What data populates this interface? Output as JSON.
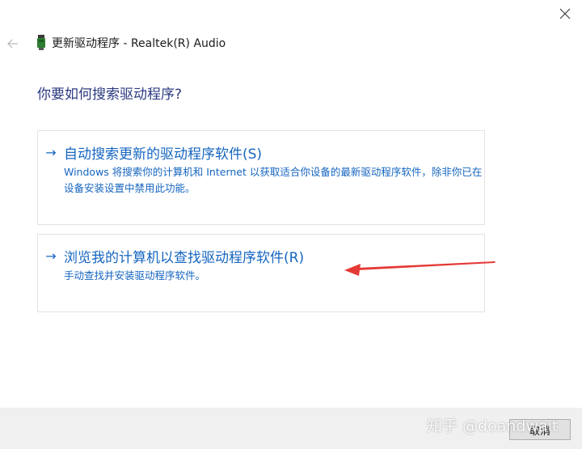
{
  "window": {
    "title": "更新驱动程序 - Realtek(R) Audio"
  },
  "page": {
    "heading": "你要如何搜索驱动程序?"
  },
  "options": [
    {
      "title": "自动搜索更新的驱动程序软件(S)",
      "description": "Windows 将搜索你的计算机和 Internet 以获取适合你设备的最新驱动程序软件，除非你已在设备安装设置中禁用此功能。"
    },
    {
      "title": "浏览我的计算机以查找驱动程序软件(R)",
      "description": "手动查找并安装驱动程序软件。"
    }
  ],
  "footer": {
    "cancel_label": "取消"
  },
  "watermark": {
    "text": "知乎 @doandwait"
  },
  "icons": {
    "close": "close-icon",
    "back": "back-arrow-icon",
    "device": "audio-device-icon",
    "option_arrow": "right-arrow-icon"
  },
  "colors": {
    "link_blue": "#1565c0",
    "annotation_red": "#e53935",
    "footer_bg": "#f0f0f0"
  }
}
